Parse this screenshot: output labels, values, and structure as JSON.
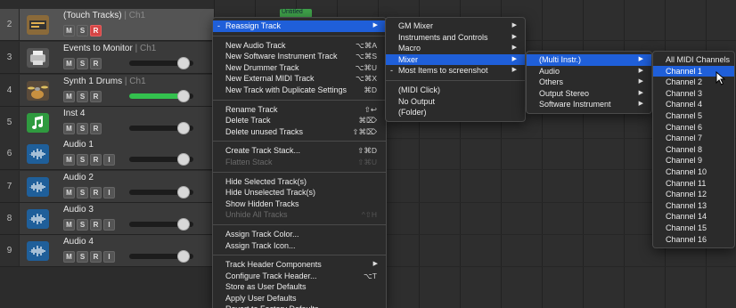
{
  "tracks": [
    {
      "num": "2",
      "name": "(Touch Tracks)",
      "channel": "Ch1",
      "icon": "touch-tracks-icon",
      "buttons": [
        "M",
        "S",
        "R"
      ],
      "rec_on": true,
      "slider": false,
      "selected": true
    },
    {
      "num": "3",
      "name": "Events to Monitor",
      "channel": "Ch1",
      "icon": "printer-icon",
      "buttons": [
        "M",
        "S",
        "R"
      ],
      "rec_on": false,
      "slider": true,
      "level": 0,
      "selected": false
    },
    {
      "num": "4",
      "name": "Synth 1 Drums",
      "channel": "Ch1",
      "icon": "drumkit-icon",
      "buttons": [
        "M",
        "S",
        "R"
      ],
      "rec_on": false,
      "slider": true,
      "level": 0.88,
      "selected": false
    },
    {
      "num": "5",
      "name": "Inst 4",
      "channel": "",
      "icon": "music-note-icon",
      "buttons": [
        "M",
        "S",
        "R"
      ],
      "rec_on": false,
      "slider": true,
      "level": 0,
      "selected": false
    },
    {
      "num": "6",
      "name": "Audio 1",
      "channel": "",
      "icon": "waveform-icon",
      "buttons": [
        "M",
        "S",
        "R",
        "I"
      ],
      "rec_on": false,
      "slider": true,
      "level": 0,
      "selected": false
    },
    {
      "num": "7",
      "name": "Audio 2",
      "channel": "",
      "icon": "waveform-icon",
      "buttons": [
        "M",
        "S",
        "R",
        "I"
      ],
      "rec_on": false,
      "slider": true,
      "level": 0,
      "selected": false
    },
    {
      "num": "8",
      "name": "Audio 3",
      "channel": "",
      "icon": "waveform-icon",
      "buttons": [
        "M",
        "S",
        "R",
        "I"
      ],
      "rec_on": false,
      "slider": true,
      "level": 0,
      "selected": false
    },
    {
      "num": "9",
      "name": "Audio 4",
      "channel": "",
      "icon": "waveform-icon",
      "buttons": [
        "M",
        "S",
        "R",
        "I"
      ],
      "rec_on": false,
      "slider": true,
      "level": 0,
      "selected": false
    }
  ],
  "region_label": "Untitled",
  "menu1": [
    {
      "label": "Reassign Track",
      "arrow": "▶",
      "hl": true,
      "dash": "-"
    },
    {
      "sep": true
    },
    {
      "label": "New Audio Track",
      "shortcut": "⌥⌘A"
    },
    {
      "label": "New Software Instrument Track",
      "shortcut": "⌥⌘S"
    },
    {
      "label": "New Drummer Track",
      "shortcut": "⌥⌘U"
    },
    {
      "label": "New External MIDI Track",
      "shortcut": "⌥⌘X"
    },
    {
      "label": "New Track with Duplicate Settings",
      "shortcut": "⌘D"
    },
    {
      "sep": true
    },
    {
      "label": "Rename Track",
      "shortcut": "⇧↩"
    },
    {
      "label": "Delete Track",
      "shortcut": "⌘⌦"
    },
    {
      "label": "Delete unused Tracks",
      "shortcut": "⇧⌘⌦"
    },
    {
      "sep": true
    },
    {
      "label": "Create Track Stack...",
      "shortcut": "⇧⌘D"
    },
    {
      "label": "Flatten Stack",
      "shortcut": "⇧⌘U",
      "dis": true
    },
    {
      "sep": true
    },
    {
      "label": "Hide Selected Track(s)"
    },
    {
      "label": "Hide Unselected Track(s)"
    },
    {
      "label": "Show Hidden Tracks"
    },
    {
      "label": "Unhide All Tracks",
      "shortcut": "^⇧H",
      "dis": true
    },
    {
      "sep": true
    },
    {
      "label": "Assign Track Color..."
    },
    {
      "label": "Assign Track Icon..."
    },
    {
      "sep": true
    },
    {
      "label": "Track Header Components",
      "arrow": "▶"
    },
    {
      "label": "Configure Track Header...",
      "shortcut": "⌥T"
    },
    {
      "label": "Store as User Defaults"
    },
    {
      "label": "Apply User Defaults"
    },
    {
      "label": "Revert to Factory Defaults"
    }
  ],
  "menu2": [
    {
      "label": "GM Mixer",
      "arrow": "▶"
    },
    {
      "label": "Instruments and Controls",
      "arrow": "▶"
    },
    {
      "label": "Macro",
      "arrow": "▶"
    },
    {
      "label": "Mixer",
      "arrow": "▶",
      "hl": true
    },
    {
      "label": "Most Items to screenshot",
      "arrow": "▶",
      "dash": "-"
    },
    {
      "sep": true
    },
    {
      "label": "(MIDI Click)"
    },
    {
      "label": "No Output"
    },
    {
      "label": "(Folder)"
    }
  ],
  "menu3": [
    {
      "label": "(Multi Instr.)",
      "arrow": "▶",
      "hl": true
    },
    {
      "label": "Audio",
      "arrow": "▶"
    },
    {
      "label": "Others",
      "arrow": "▶"
    },
    {
      "label": "Output Stereo",
      "arrow": "▶"
    },
    {
      "label": "Software Instrument",
      "arrow": "▶"
    }
  ],
  "menu4": [
    {
      "label": "All MIDI Channels"
    },
    {
      "label": "Channel  1",
      "hl": true
    },
    {
      "label": "Channel  2"
    },
    {
      "label": "Channel  3"
    },
    {
      "label": "Channel  4"
    },
    {
      "label": "Channel  5"
    },
    {
      "label": "Channel  6"
    },
    {
      "label": "Channel  7"
    },
    {
      "label": "Channel  8"
    },
    {
      "label": "Channel  9"
    },
    {
      "label": "Channel 10"
    },
    {
      "label": "Channel 11"
    },
    {
      "label": "Channel 12"
    },
    {
      "label": "Channel 13"
    },
    {
      "label": "Channel 14"
    },
    {
      "label": "Channel 15"
    },
    {
      "label": "Channel 16"
    }
  ],
  "colors": {
    "highlight": "#1f5fd9",
    "record": "#d64545",
    "level": "#33c14e",
    "region": "#3fa14a"
  }
}
